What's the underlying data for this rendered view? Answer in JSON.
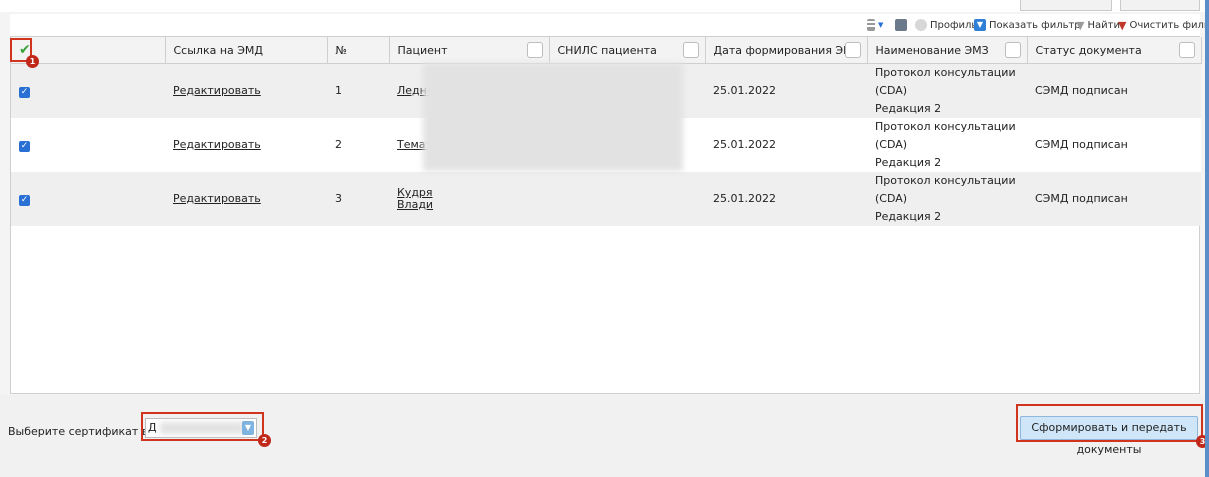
{
  "toolbar": {
    "profile_label": "Профиль",
    "show_filter_label": "Показать фильтр",
    "find_label": "Найти",
    "clear_filter_label": "Очистить фильтр"
  },
  "table": {
    "columns": [
      "",
      "Ссылка на ЭМД",
      "№",
      "Пациент",
      "СНИЛС пациента",
      "Дата формирования ЭМД",
      "Наименование ЭМЗ",
      "Статус документа"
    ],
    "rows": [
      {
        "checked": true,
        "link": "Редактировать",
        "num": "1",
        "patient": "Ледне",
        "patient2": "",
        "date": "25.01.2022",
        "name1": "Протокол консультации (CDA)",
        "name2": "Редакция 2",
        "status": "СЭМД подписан"
      },
      {
        "checked": true,
        "link": "Редактировать",
        "num": "2",
        "patient": "Темат",
        "patient2": "",
        "date": "25.01.2022",
        "name1": "Протокол консультации (CDA)",
        "name2": "Редакция 2",
        "status": "СЭМД подписан"
      },
      {
        "checked": true,
        "link": "Редактировать",
        "num": "3",
        "patient": "Кудря",
        "patient2": "Влади",
        "date": "25.01.2022",
        "name1": "Протокол консультации (CDA)",
        "name2": "Редакция 2",
        "status": "СЭМД подписан"
      }
    ]
  },
  "footer": {
    "cert_label": "Выберите сертификат врача:",
    "cert_value": "Д",
    "submit_label": "Сформировать и передать документы"
  },
  "badges": [
    "1",
    "2",
    "3"
  ],
  "colors": {
    "accent": "#2a6fd4",
    "annotation": "#d0341f",
    "button_bg": "#cfe6f8"
  }
}
